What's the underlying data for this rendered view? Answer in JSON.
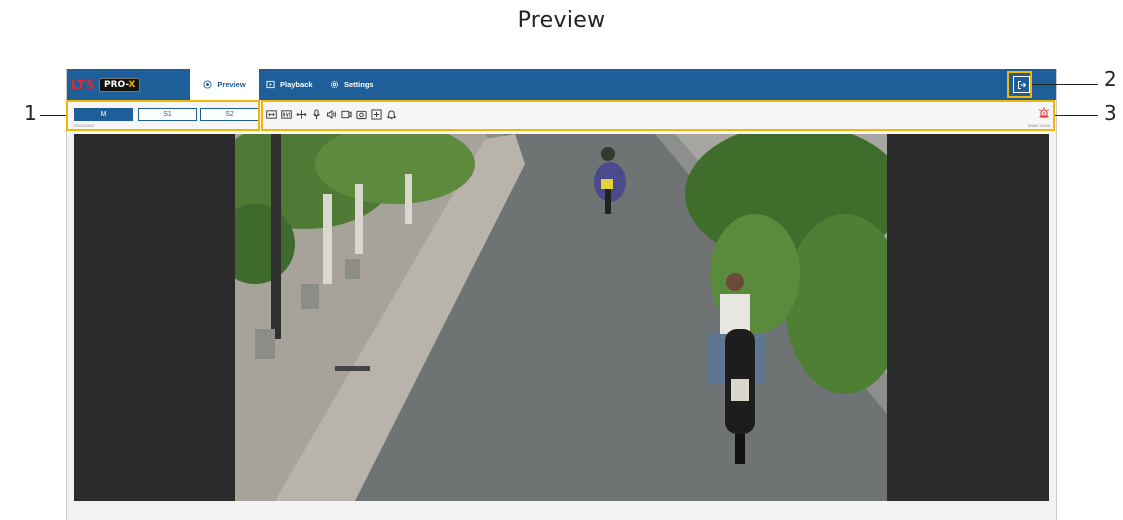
{
  "doc_title": "Preview",
  "app": {
    "logo": {
      "brand": "LTS",
      "product_prefix": "PRO-",
      "product_suffix": "X"
    },
    "nav": [
      {
        "label": "Preview",
        "icon": "eye-icon",
        "active": true
      },
      {
        "label": "Playback",
        "icon": "playback-icon",
        "active": false
      },
      {
        "label": "Settings",
        "icon": "gear-icon",
        "active": false
      }
    ],
    "logout_icon": "logout-icon",
    "colors": {
      "nav_bg": "#1e5f9a",
      "accent": "#1e5f9a",
      "callout": "#f2b705",
      "alarm": "#e2262b"
    }
  },
  "toolbar": {
    "streams": [
      {
        "label": "M",
        "active": true
      },
      {
        "label": "S1",
        "active": false
      },
      {
        "label": "S2",
        "active": false
      }
    ],
    "tools": [
      "fit-ratio-icon",
      "original-size-icon",
      "fisheye-icon",
      "microphone-icon",
      "speaker-icon",
      "record-icon",
      "snapshot-icon",
      "zoom-icon",
      "alarm-out-icon"
    ],
    "alarm_icon": "siren-icon",
    "stream_info": "2592x1944",
    "rate_info": "3686K 25/25"
  },
  "callouts": [
    {
      "number": "1"
    },
    {
      "number": "2"
    },
    {
      "number": "3"
    }
  ]
}
